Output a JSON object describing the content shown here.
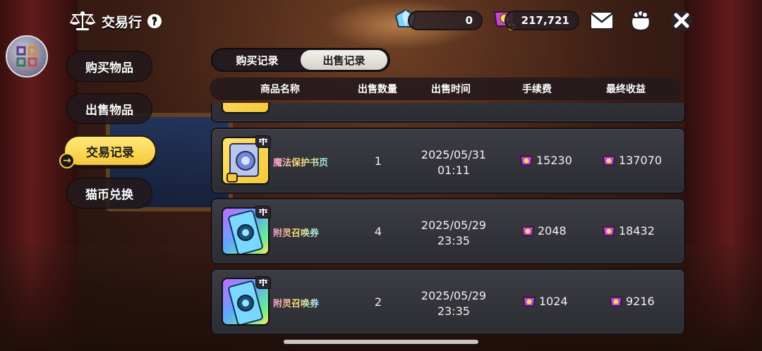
{
  "header": {
    "title": "交易行",
    "help": "?"
  },
  "currencies": {
    "gems": "0",
    "coins": "217,721"
  },
  "menu": {
    "items": [
      {
        "label": "购买物品"
      },
      {
        "label": "出售物品"
      },
      {
        "label": "交易记录"
      },
      {
        "label": "猫币兑换"
      }
    ],
    "active_arrow": "→"
  },
  "tabs": {
    "buy_record": "购买记录",
    "sell_record": "出售记录"
  },
  "table": {
    "columns": [
      "商品名称",
      "出售数量",
      "出售时间",
      "手续费",
      "最终收益"
    ],
    "rows": [
      {
        "name": "魔法保护书页",
        "qty": "1",
        "date": "2025/05/31",
        "time": "01:11",
        "fee": "15230",
        "income": "137070"
      },
      {
        "name": "附灵召唤券",
        "qty": "4",
        "date": "2025/05/29",
        "time": "23:35",
        "fee": "2048",
        "income": "18432"
      },
      {
        "name": "附灵召唤券",
        "qty": "2",
        "date": "2025/05/29",
        "time": "23:35",
        "fee": "1024",
        "income": "9216"
      }
    ]
  },
  "colors": {
    "accent_yellow": "#f7c73a",
    "row_bg": "#34343c",
    "panel_dark": "#231b1f"
  },
  "icons": [
    "scale-icon",
    "help-icon",
    "gem-icon",
    "coin-icon",
    "mail-icon",
    "bag-icon",
    "close-icon",
    "coin-small-icon"
  ]
}
